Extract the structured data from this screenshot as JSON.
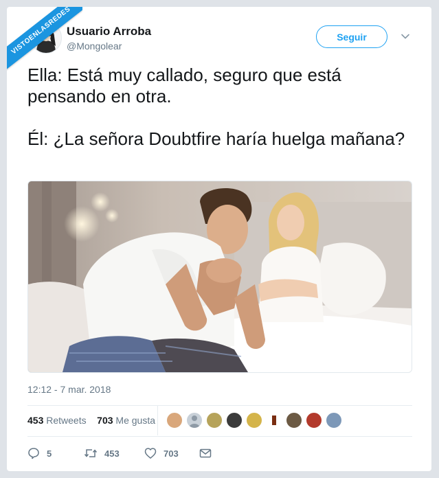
{
  "watermark": "VISTOENLASREDES",
  "tweet": {
    "user_name": "Usuario Arroba",
    "handle": "@Mongolear",
    "follow_label": "Seguir",
    "text": "Ella: Está muy callado, seguro que está pensando en otra.\n\nÉl: ¿La señora Doubtfire haría huelga mañana?",
    "timestamp": "12:12 - 7 mar. 2018",
    "retweets_count": "453",
    "retweets_label": "Retweets",
    "likes_count": "703",
    "likes_label": "Me gusta",
    "actions": {
      "reply_count": "5",
      "retweet_count": "453",
      "like_count": "703"
    }
  },
  "colors": {
    "accent": "#1da1f2",
    "muted": "#657786",
    "text": "#14171a",
    "watermark_bg": "#1b95e0"
  }
}
